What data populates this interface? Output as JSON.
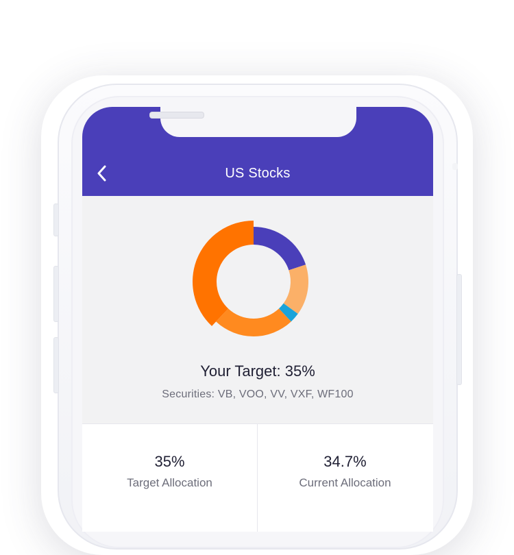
{
  "screen": {
    "title": "US Stocks",
    "target_text": "Your Target: 35%",
    "securities_text": "Securities: VB, VOO, VV, VXF, WF100"
  },
  "icons": {
    "back": "chevron-left-icon"
  },
  "colors": {
    "header": "#4a3fb9",
    "segment_purple": "#4a3fb9",
    "segment_light_orange": "#fbb068",
    "segment_blue": "#1aa3d9",
    "segment_orange": "#ff8a1f",
    "segment_dark_orange": "#ff7300"
  },
  "chart_data": {
    "type": "pie",
    "variant": "donut",
    "segments": [
      {
        "value": 20,
        "color": "#4a3fb9"
      },
      {
        "value": 15,
        "color": "#fbb068"
      },
      {
        "value": 3,
        "color": "#1aa3d9"
      },
      {
        "value": 24,
        "color": "#ff8a1f"
      },
      {
        "value": 38,
        "color": "#ff7300",
        "exploded": true
      }
    ]
  },
  "stats": [
    {
      "value": "35%",
      "label": "Target Allocation"
    },
    {
      "value": "34.7%",
      "label": "Current Allocation"
    }
  ]
}
